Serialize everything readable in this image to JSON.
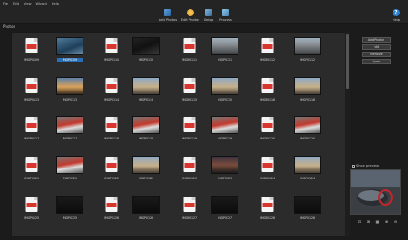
{
  "menu": {
    "items": [
      "File",
      "Edit",
      "View",
      "Wizard",
      "Help"
    ]
  },
  "toolbar": {
    "add_photos": "Add Photos",
    "edit_photos": "Edit Photos",
    "setup": "Setup",
    "process": "Process",
    "help": "Help"
  },
  "photos_label": "Photos",
  "grid": {
    "rows": [
      [
        {
          "name": "IMGP0109",
          "kind": "raw"
        },
        {
          "name": "IMGP0109",
          "kind": "photo",
          "tone": "blue",
          "selected": true
        },
        {
          "name": "IMGP0110",
          "kind": "raw"
        },
        {
          "name": "IMGP0110",
          "kind": "photo",
          "tone": "dark"
        },
        {
          "name": "IMGP0111",
          "kind": "raw"
        },
        {
          "name": "IMGP0111",
          "kind": "photo",
          "tone": "building"
        },
        {
          "name": "IMGP0112",
          "kind": "raw"
        },
        {
          "name": "IMGP0112",
          "kind": "photo",
          "tone": "building"
        }
      ],
      [
        {
          "name": "IMGP0113",
          "kind": "raw"
        },
        {
          "name": "IMGP0113",
          "kind": "photo",
          "tone": "sunset"
        },
        {
          "name": "IMGP0114",
          "kind": "raw"
        },
        {
          "name": "IMGP0114",
          "kind": "photo",
          "tone": "city"
        },
        {
          "name": "IMGP0115",
          "kind": "raw"
        },
        {
          "name": "IMGP0115",
          "kind": "photo",
          "tone": "city"
        },
        {
          "name": "IMGP0116",
          "kind": "raw"
        },
        {
          "name": "IMGP0116",
          "kind": "photo",
          "tone": "city"
        }
      ],
      [
        {
          "name": "IMGP0117",
          "kind": "raw"
        },
        {
          "name": "IMGP0117",
          "kind": "photo",
          "tone": "truck"
        },
        {
          "name": "IMGP0118",
          "kind": "raw"
        },
        {
          "name": "IMGP0118",
          "kind": "photo",
          "tone": "truck"
        },
        {
          "name": "IMGP0119",
          "kind": "raw"
        },
        {
          "name": "IMGP0119",
          "kind": "photo",
          "tone": "truck"
        },
        {
          "name": "IMGP0120",
          "kind": "raw"
        },
        {
          "name": "IMGP0120",
          "kind": "photo",
          "tone": "truck"
        }
      ],
      [
        {
          "name": "IMGP0121",
          "kind": "raw"
        },
        {
          "name": "IMGP0121",
          "kind": "photo",
          "tone": "truck"
        },
        {
          "name": "IMGP0122",
          "kind": "raw"
        },
        {
          "name": "IMGP0122",
          "kind": "photo",
          "tone": "city"
        },
        {
          "name": "IMGP0123",
          "kind": "raw"
        },
        {
          "name": "IMGP0123",
          "kind": "photo",
          "tone": "dusk"
        },
        {
          "name": "IMGP0124",
          "kind": "raw"
        },
        {
          "name": "IMGP0124",
          "kind": "photo",
          "tone": "city"
        }
      ],
      [
        {
          "name": "IMGP0125",
          "kind": "raw"
        },
        {
          "name": "IMGP0125",
          "kind": "photo",
          "tone": "black"
        },
        {
          "name": "IMGP0126",
          "kind": "raw"
        },
        {
          "name": "IMGP0126",
          "kind": "photo",
          "tone": "black"
        },
        {
          "name": "IMGP0127",
          "kind": "raw"
        },
        {
          "name": "IMGP0127",
          "kind": "photo",
          "tone": "black"
        },
        {
          "name": "IMGP0128",
          "kind": "raw"
        },
        {
          "name": "IMGP0128",
          "kind": "photo",
          "tone": "black"
        }
      ]
    ]
  },
  "side_buttons": [
    "Add Photos",
    "Edit",
    "Remove",
    "Open"
  ],
  "preview": {
    "label": "Show preview",
    "tools": [
      "fit-icon",
      "actual-size-icon",
      "grid-icon",
      "zoom-in-icon",
      "zoom-out-icon"
    ]
  },
  "colors": {
    "accent": "#2a6fb6",
    "raw_band": "#d7352e"
  }
}
